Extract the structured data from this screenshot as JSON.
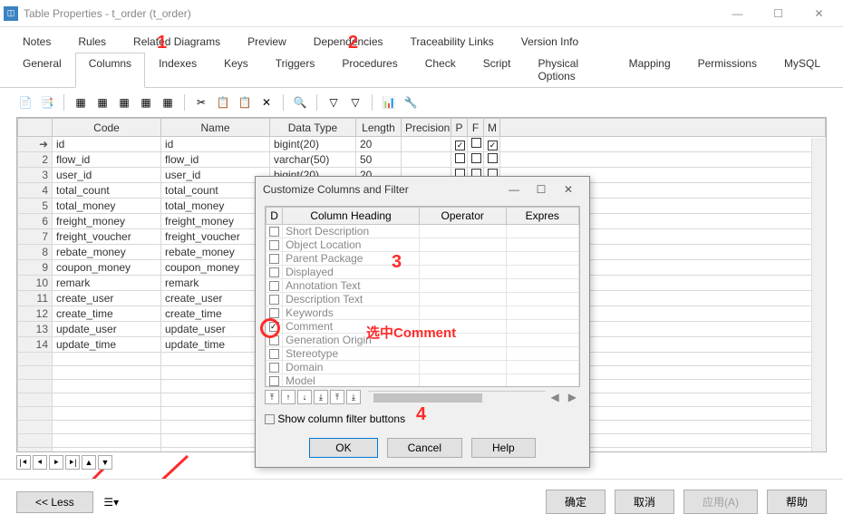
{
  "window": {
    "title": "Table Properties - t_order (t_order)"
  },
  "tabs_row1": [
    "Notes",
    "Rules",
    "Related Diagrams",
    "Preview",
    "Dependencies",
    "Traceability Links",
    "Version Info"
  ],
  "tabs_row2": [
    "General",
    "Columns",
    "Indexes",
    "Keys",
    "Triggers",
    "Procedures",
    "Check",
    "Script",
    "Physical Options",
    "Mapping",
    "Permissions",
    "MySQL"
  ],
  "active_tab": "Columns",
  "grid": {
    "headers": [
      "",
      "Code",
      "Name",
      "Data Type",
      "Length",
      "Precision",
      "P",
      "F",
      "M"
    ],
    "rows": [
      {
        "n": "",
        "arrow": true,
        "code": "id",
        "name": "id",
        "dtype": "bigint(20)",
        "len": "20",
        "prec": "",
        "p": true,
        "f": false,
        "m": true
      },
      {
        "n": "2",
        "code": "flow_id",
        "name": "flow_id",
        "dtype": "varchar(50)",
        "len": "50",
        "prec": "",
        "p": false,
        "f": false,
        "m": false
      },
      {
        "n": "3",
        "code": "user_id",
        "name": "user_id",
        "dtype": "bigint(20)",
        "len": "20",
        "prec": "",
        "p": false,
        "f": false,
        "m": false
      },
      {
        "n": "4",
        "code": "total_count",
        "name": "total_count",
        "dtype": "",
        "len": "",
        "prec": "",
        "p": false,
        "f": false,
        "m": false
      },
      {
        "n": "5",
        "code": "total_money",
        "name": "total_money",
        "dtype": "",
        "len": "",
        "prec": "",
        "p": false,
        "f": false,
        "m": false
      },
      {
        "n": "6",
        "code": "freight_money",
        "name": "freight_money",
        "dtype": "",
        "len": "",
        "prec": "",
        "p": false,
        "f": false,
        "m": false
      },
      {
        "n": "7",
        "code": "freight_voucher",
        "name": "freight_voucher",
        "dtype": "",
        "len": "",
        "prec": "",
        "p": false,
        "f": false,
        "m": false
      },
      {
        "n": "8",
        "code": "rebate_money",
        "name": "rebate_money",
        "dtype": "",
        "len": "",
        "prec": "",
        "p": false,
        "f": false,
        "m": false
      },
      {
        "n": "9",
        "code": "coupon_money",
        "name": "coupon_money",
        "dtype": "",
        "len": "",
        "prec": "",
        "p": false,
        "f": false,
        "m": false
      },
      {
        "n": "10",
        "code": "remark",
        "name": "remark",
        "dtype": "",
        "len": "",
        "prec": "",
        "p": false,
        "f": false,
        "m": false
      },
      {
        "n": "11",
        "code": "create_user",
        "name": "create_user",
        "dtype": "",
        "len": "",
        "prec": "",
        "p": false,
        "f": false,
        "m": false
      },
      {
        "n": "12",
        "code": "create_time",
        "name": "create_time",
        "dtype": "",
        "len": "",
        "prec": "",
        "p": false,
        "f": false,
        "m": false
      },
      {
        "n": "13",
        "code": "update_user",
        "name": "update_user",
        "dtype": "",
        "len": "",
        "prec": "",
        "p": false,
        "f": false,
        "m": false
      },
      {
        "n": "14",
        "code": "update_time",
        "name": "update_time",
        "dtype": "",
        "len": "",
        "prec": "",
        "p": false,
        "f": false,
        "m": false
      }
    ]
  },
  "dialog": {
    "title": "Customize Columns and Filter",
    "col_headers": [
      "D",
      "Column Heading",
      "Operator",
      "Expres"
    ],
    "items": [
      {
        "label": "Short Description",
        "checked": false
      },
      {
        "label": "Object Location",
        "checked": false
      },
      {
        "label": "Parent Package",
        "checked": false
      },
      {
        "label": "Displayed",
        "checked": false
      },
      {
        "label": "Annotation Text",
        "checked": false
      },
      {
        "label": "Description Text",
        "checked": false
      },
      {
        "label": "Keywords",
        "checked": false
      },
      {
        "label": "Comment",
        "checked": true
      },
      {
        "label": "Generation Origin",
        "checked": false
      },
      {
        "label": "Stereotype",
        "checked": false
      },
      {
        "label": "Domain",
        "checked": false
      },
      {
        "label": "Model",
        "checked": false
      }
    ],
    "show_filter_label": "Show column filter buttons",
    "ok": "OK",
    "cancel": "Cancel",
    "help": "Help"
  },
  "footer": {
    "less": "<< Less",
    "ok": "确定",
    "cancel": "取消",
    "apply": "应用(A)",
    "help": "帮助"
  },
  "annotations": {
    "a1": "1",
    "a2": "2",
    "a3": "3",
    "a4": "4",
    "comment_label": "选中Comment"
  }
}
